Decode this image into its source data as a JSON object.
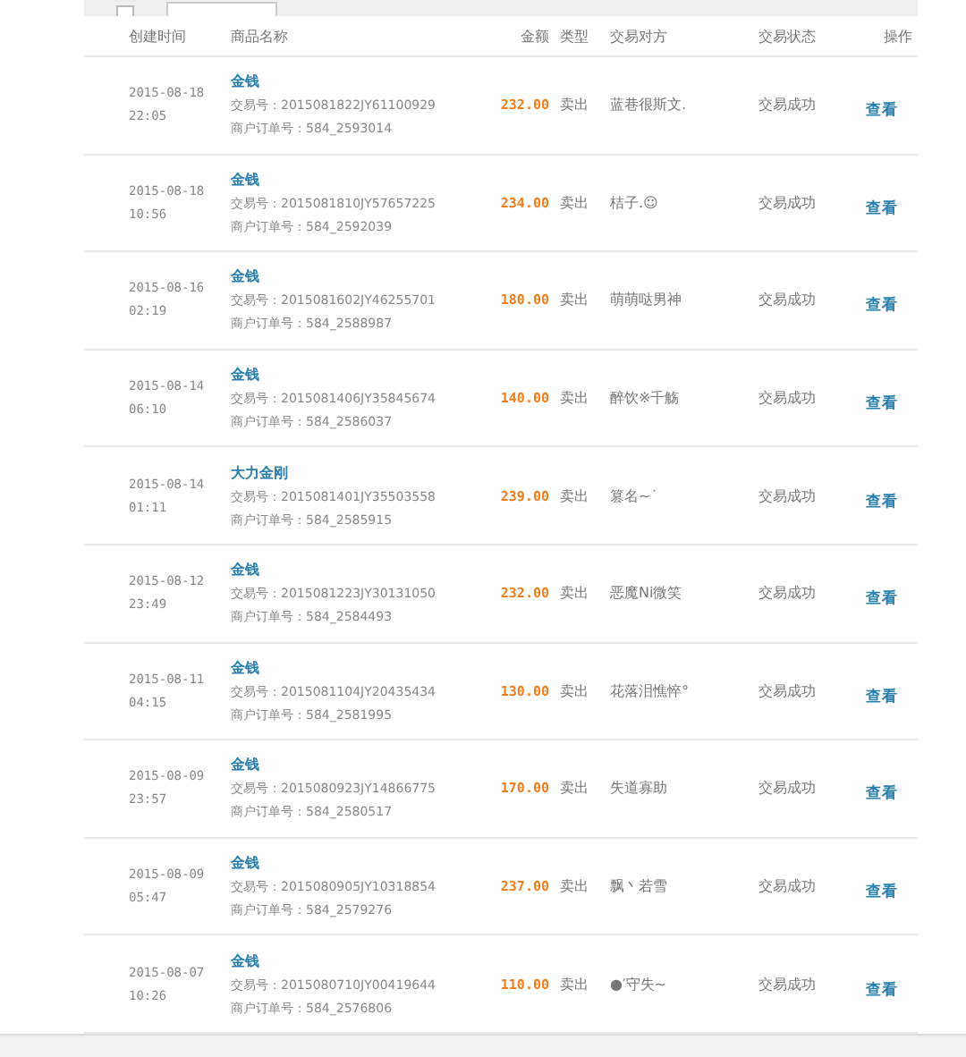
{
  "toolbar": {
    "select_all": {
      "checked": false
    }
  },
  "table": {
    "columns": [
      "创建时间",
      "商品名称",
      "金额",
      "类型",
      "交易对方",
      "交易状态",
      "操作"
    ],
    "rows": [
      {
        "date": "2015-08-18",
        "time": "22:05",
        "product": "金钱",
        "trade_no": "交易号：2015081822JY61100929",
        "order_no": "商户订单号：584_2593014",
        "amount": "232.00",
        "type": "卖出",
        "counterparty": "蓝巷很斯文.",
        "status": "交易成功",
        "action": "查看"
      },
      {
        "date": "2015-08-18",
        "time": "10:56",
        "product": "金钱",
        "trade_no": "交易号：2015081810JY57657225",
        "order_no": "商户订单号：584_2592039",
        "amount": "234.00",
        "type": "卖出",
        "counterparty": "桔子.☺",
        "status": "交易成功",
        "action": "查看"
      },
      {
        "date": "2015-08-16",
        "time": "02:19",
        "product": "金钱",
        "trade_no": "交易号：2015081602JY46255701",
        "order_no": "商户订单号：584_2588987",
        "amount": "180.00",
        "type": "卖出",
        "counterparty": "萌萌哒男神",
        "status": "交易成功",
        "action": "查看"
      },
      {
        "date": "2015-08-14",
        "time": "06:10",
        "product": "金钱",
        "trade_no": "交易号：2015081406JY35845674",
        "order_no": "商户订单号：584_2586037",
        "amount": "140.00",
        "type": "卖出",
        "counterparty": "醉饮※千觞",
        "status": "交易成功",
        "action": "查看"
      },
      {
        "date": "2015-08-14",
        "time": "01:11",
        "product": "大力金刚",
        "trade_no": "交易号：2015081401JY35503558",
        "order_no": "商户订单号：584_2585915",
        "amount": "239.00",
        "type": "卖出",
        "counterparty": "篡名~˙",
        "status": "交易成功",
        "action": "查看"
      },
      {
        "date": "2015-08-12",
        "time": "23:49",
        "product": "金钱",
        "trade_no": "交易号：2015081223JY30131050",
        "order_no": "商户订单号：584_2584493",
        "amount": "232.00",
        "type": "卖出",
        "counterparty": "恶魔Ni微笑",
        "status": "交易成功",
        "action": "查看"
      },
      {
        "date": "2015-08-11",
        "time": "04:15",
        "product": "金钱",
        "trade_no": "交易号：2015081104JY20435434",
        "order_no": "商户订单号：584_2581995",
        "amount": "130.00",
        "type": "卖出",
        "counterparty": "花落泪憔悴°",
        "status": "交易成功",
        "action": "查看"
      },
      {
        "date": "2015-08-09",
        "time": "23:57",
        "product": "金钱",
        "trade_no": "交易号：2015080923JY14866775",
        "order_no": "商户订单号：584_2580517",
        "amount": "170.00",
        "type": "卖出",
        "counterparty": "失道寡助",
        "status": "交易成功",
        "action": "查看"
      },
      {
        "date": "2015-08-09",
        "time": "05:47",
        "product": "金钱",
        "trade_no": "交易号：2015080905JY10318854",
        "order_no": "商户订单号：584_2579276",
        "amount": "237.00",
        "type": "卖出",
        "counterparty": "飘丶若雪",
        "status": "交易成功",
        "action": "查看"
      },
      {
        "date": "2015-08-07",
        "time": "10:26",
        "product": "金钱",
        "trade_no": "交易号：2015080710JY00419644",
        "order_no": "商户订单号：584_2576806",
        "amount": "110.00",
        "type": "卖出",
        "counterparty": "●′守失~",
        "status": "交易成功",
        "action": "查看"
      }
    ]
  }
}
